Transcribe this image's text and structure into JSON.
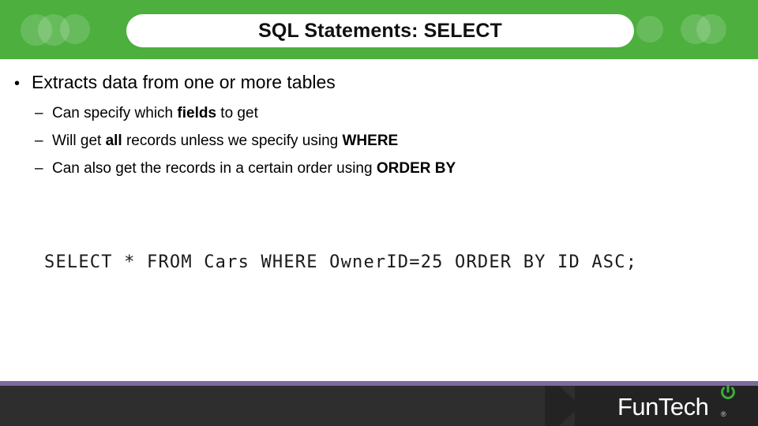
{
  "slide": {
    "title": "SQL Statements: SELECT",
    "theme": {
      "header_green": "#4CAF3E",
      "title_pill_background": "#FFFFFF",
      "title_color": "#101010",
      "body_text_color": "#000000",
      "footer_rule_purple": "#7E6A9E",
      "footer_dark": "#2E2E2E",
      "footer_dark_accent": "#232323",
      "logo_accent_green": "#3FAE3C"
    }
  },
  "body": {
    "bullet_marker": "•",
    "dash_marker": "–",
    "main_bullet": "Extracts data from one or more tables",
    "sub_bullets": [
      {
        "segments": [
          {
            "text": "Can specify which ",
            "bold": false
          },
          {
            "text": "fields",
            "bold": true
          },
          {
            "text": " to get",
            "bold": false
          }
        ]
      },
      {
        "segments": [
          {
            "text": "Will get ",
            "bold": false
          },
          {
            "text": "all",
            "bold": true
          },
          {
            "text": " records unless we specify using ",
            "bold": false
          },
          {
            "text": "WHERE",
            "bold": true
          }
        ]
      },
      {
        "segments": [
          {
            "text": "Can also get the records in a certain order using ",
            "bold": false
          },
          {
            "text": "ORDER BY",
            "bold": true
          }
        ]
      }
    ],
    "code_example": "SELECT * FROM Cars WHERE OwnerID=25 ORDER BY ID ASC;"
  },
  "footer": {
    "logo_text": "FunTech",
    "logo_registered_mark": "®",
    "logo_icon": "power-icon"
  }
}
